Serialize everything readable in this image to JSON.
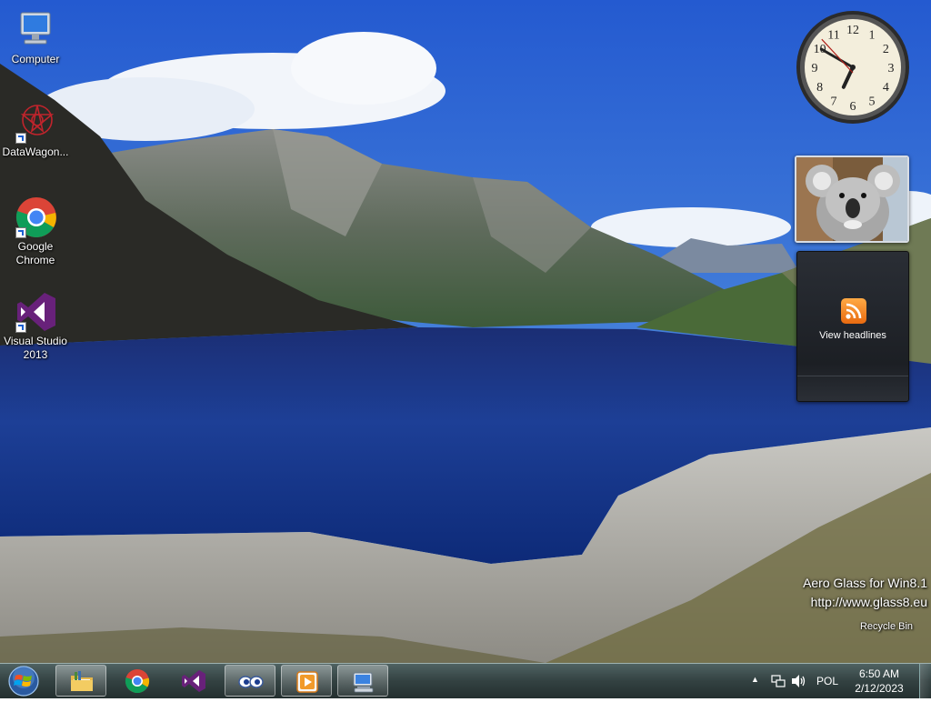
{
  "desktop": {
    "icons": [
      {
        "label": "Computer",
        "icon": "computer-icon"
      },
      {
        "label": "DataWagon...",
        "icon": "datawagon-icon"
      },
      {
        "label": "Google\nChrome",
        "icon": "chrome-icon"
      },
      {
        "label": "Visual Studio\n2013",
        "icon": "visual-studio-icon"
      }
    ],
    "recycle_bin": {
      "label": "Recycle Bin"
    }
  },
  "gadgets": {
    "clock": {
      "hour": 6,
      "minute": 50,
      "second": 52
    },
    "feed": {
      "label": "View headlines",
      "icon": "rss-icon"
    }
  },
  "watermark": {
    "line1": "Aero Glass for Win8.1",
    "line2": "http://www.glass8.eu"
  },
  "taskbar": {
    "pinned": [
      {
        "name": "windows-explorer",
        "icon": "folder-icon"
      },
      {
        "name": "google-chrome",
        "icon": "chrome-icon"
      },
      {
        "name": "visual-studio",
        "icon": "visual-studio-icon"
      },
      {
        "name": "eyes-app",
        "icon": "eyes-icon"
      },
      {
        "name": "media-player",
        "icon": "media-player-icon"
      },
      {
        "name": "remote-desktop",
        "icon": "remote-desktop-icon"
      }
    ],
    "tray": {
      "language": "POL",
      "time": "6:50 AM",
      "date": "2/12/2023"
    }
  },
  "colors": {
    "sky": "#3c78d6",
    "lake": "#1f3f8f",
    "taskbar": "#2c3c3c",
    "vs_purple": "#68217a",
    "rss_orange": "#f08a24"
  }
}
